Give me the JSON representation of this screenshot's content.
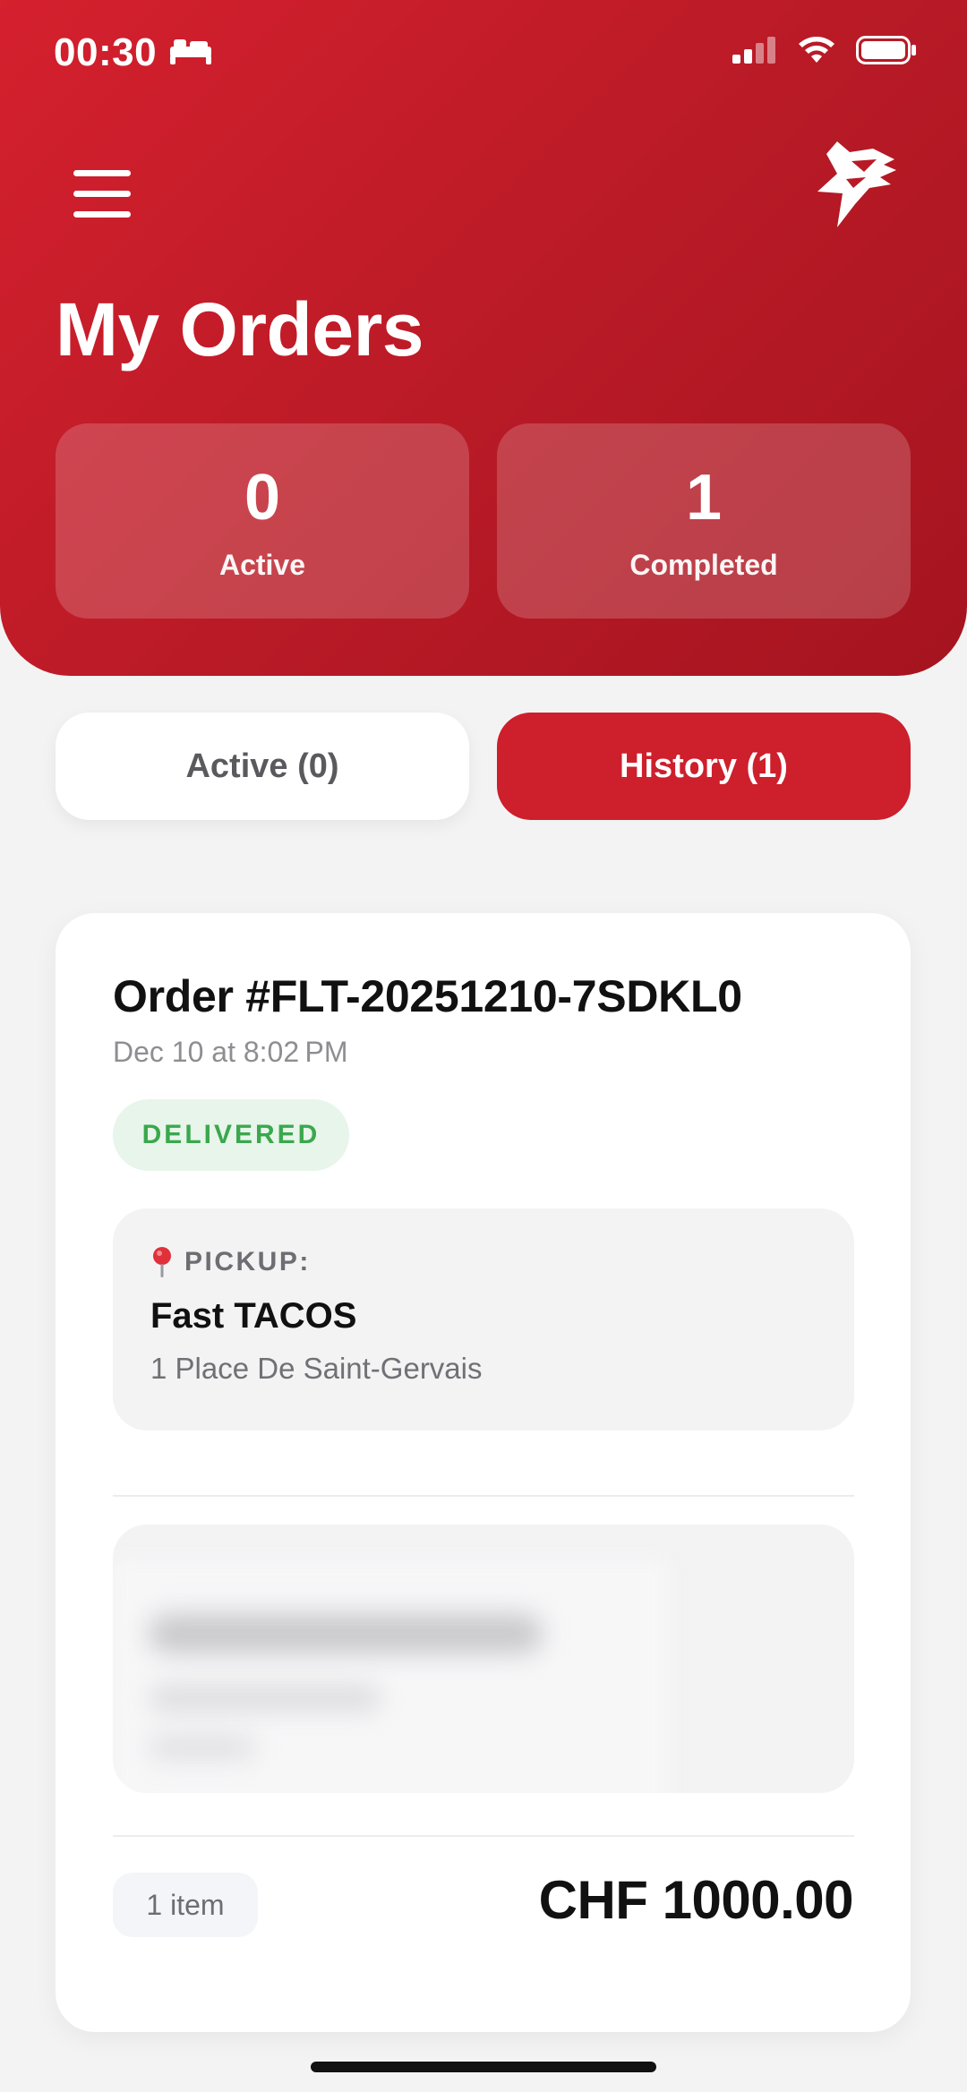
{
  "status_bar": {
    "time": "00:30"
  },
  "header": {
    "title": "My Orders"
  },
  "stats": {
    "active_count": "0",
    "active_label": "Active",
    "completed_count": "1",
    "completed_label": "Completed"
  },
  "tabs": [
    {
      "label": "Active (0)",
      "selected": false
    },
    {
      "label": "History (1)",
      "selected": true
    }
  ],
  "order": {
    "title": "Order #FLT-20251210-7SDKL0",
    "date": "Dec 10 at 8:02 PM",
    "status": "DELIVERED",
    "pickup": {
      "label": "PICKUP:",
      "name": "Fast TACOS",
      "address": "1 Place De Saint-Gervais"
    },
    "item_count": "1 item",
    "total": "CHF 1000.00"
  },
  "colors": {
    "brand_red": "#cd1f2c",
    "delivered_green": "#3aa84d"
  }
}
